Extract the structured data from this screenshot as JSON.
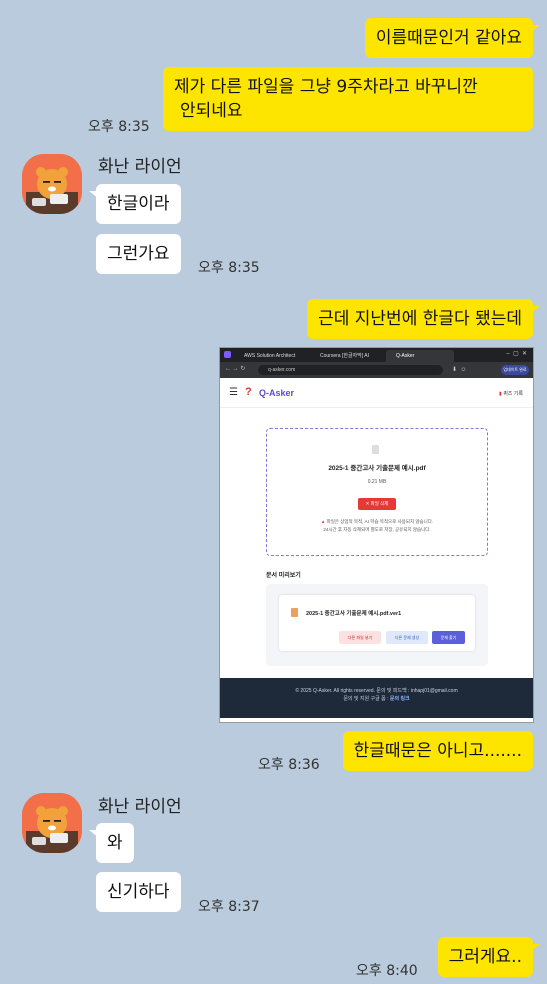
{
  "messages": {
    "m1": "이름때문인거 같아요",
    "m2_line1": "제가 다른 파일을 그냥 9주차라고 바꾸니깐",
    "m2_line2": "안되네요",
    "t1": "오후 8:35",
    "sender": "화난 라이언",
    "m3": "한글이라",
    "m4": "그런가요",
    "t2": "오후 8:35",
    "m5": "근데 지난번에 한글다 됐는데",
    "m6": "한글때문은 아니고.......",
    "t3": "오후 8:36",
    "sender2": "화난 라이언",
    "m7": "와",
    "m8": "신기하다",
    "t4": "오후 8:37",
    "m9": "그러게요..",
    "t5": "오후 8:40"
  },
  "screenshot": {
    "tabs": [
      "AWS Solution Architect",
      "Coursera [한글자막] AI",
      "Q-Asker"
    ],
    "url": "q-asker.com",
    "profile_label": "업데이트 완료",
    "app_name": "Q-Asker",
    "quiz_record": "퀴즈 기록",
    "file_name": "2025-1 중간고사 기출문제 예시.pdf",
    "file_size": "0.21 MB",
    "delete_button": "✕ 파일 삭제",
    "notice_line1": "파일은 상업적 목적, AI 학습 목적으로 사용되지 않습니다.",
    "notice_line2": "24시간 후 자동 삭제되며 별도로 저장, 공유되지 않습니다.",
    "preview_title": "문서 미리보기",
    "preview_file": "2025-1 중간고사 기출문제 예시.pdf.ver1",
    "btn_other_file": "다른 파일 넣기",
    "btn_other_gen": "다른 문제 생성",
    "btn_solve": "문제 풀기",
    "footer_line1": "© 2025 Q-Asker. All rights reserved. 문의 및 피드백 : inhapj01@gmail.com",
    "footer_line2_prefix": "문의 및 지원 구글 폼 : ",
    "footer_link": "문의 링크"
  }
}
